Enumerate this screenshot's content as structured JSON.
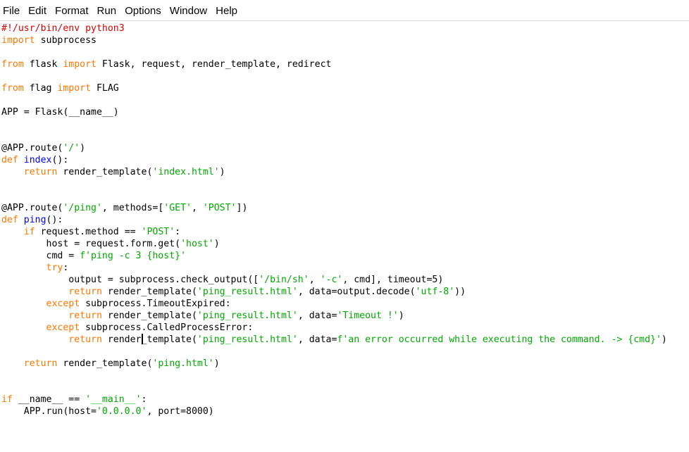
{
  "menubar": {
    "items": [
      "File",
      "Edit",
      "Format",
      "Run",
      "Options",
      "Window",
      "Help"
    ]
  },
  "colors": {
    "keyword": "#ff7700",
    "string": "#00aa00",
    "definition": "#0000ff",
    "comment": "#dd0000",
    "text": "#000000"
  },
  "editor": {
    "cursor_line": 28,
    "lines": [
      [
        [
          "cmt",
          "#!/usr/bin/env python3"
        ]
      ],
      [
        [
          "kw",
          "import"
        ],
        [
          "",
          " subprocess"
        ]
      ],
      [],
      [
        [
          "kw",
          "from"
        ],
        [
          "",
          " flask "
        ],
        [
          "kw",
          "import"
        ],
        [
          "",
          " Flask, request, render_template, redirect"
        ]
      ],
      [],
      [
        [
          "kw",
          "from"
        ],
        [
          "",
          " flag "
        ],
        [
          "kw",
          "import"
        ],
        [
          "",
          " FLAG"
        ]
      ],
      [],
      [
        [
          "",
          "APP = Flask(__name__)"
        ]
      ],
      [],
      [],
      [
        [
          "",
          "@APP.route("
        ],
        [
          "str",
          "'/'"
        ],
        [
          "",
          ")"
        ]
      ],
      [
        [
          "kw",
          "def"
        ],
        [
          "",
          " "
        ],
        [
          "def",
          "index"
        ],
        [
          "",
          "():"
        ]
      ],
      [
        [
          "",
          "    "
        ],
        [
          "kw",
          "return"
        ],
        [
          "",
          " render_template("
        ],
        [
          "str",
          "'index.html'"
        ],
        [
          "",
          ")"
        ]
      ],
      [],
      [],
      [
        [
          "",
          "@APP.route("
        ],
        [
          "str",
          "'/ping'"
        ],
        [
          "",
          ", methods=["
        ],
        [
          "str",
          "'GET'"
        ],
        [
          "",
          ", "
        ],
        [
          "str",
          "'POST'"
        ],
        [
          "",
          "])"
        ]
      ],
      [
        [
          "kw",
          "def"
        ],
        [
          "",
          " "
        ],
        [
          "def",
          "ping"
        ],
        [
          "",
          "():"
        ]
      ],
      [
        [
          "",
          "    "
        ],
        [
          "kw",
          "if"
        ],
        [
          "",
          " request.method == "
        ],
        [
          "str",
          "'POST'"
        ],
        [
          "",
          ":"
        ]
      ],
      [
        [
          "",
          "        host = request.form.get("
        ],
        [
          "str",
          "'host'"
        ],
        [
          "",
          ")"
        ]
      ],
      [
        [
          "",
          "        cmd = "
        ],
        [
          "str",
          "f'ping -c 3 {host}'"
        ]
      ],
      [
        [
          "",
          "        "
        ],
        [
          "kw",
          "try"
        ],
        [
          "",
          ":"
        ]
      ],
      [
        [
          "",
          "            output = subprocess.check_output(["
        ],
        [
          "str",
          "'/bin/sh'"
        ],
        [
          "",
          ", "
        ],
        [
          "str",
          "'-c'"
        ],
        [
          "",
          ", cmd], timeout=5)"
        ]
      ],
      [
        [
          "",
          "            "
        ],
        [
          "kw",
          "return"
        ],
        [
          "",
          " render_template("
        ],
        [
          "str",
          "'ping_result.html'"
        ],
        [
          "",
          ", data=output.decode("
        ],
        [
          "str",
          "'utf-8'"
        ],
        [
          "",
          "))"
        ]
      ],
      [
        [
          "",
          "        "
        ],
        [
          "kw",
          "except"
        ],
        [
          "",
          " subprocess.TimeoutExpired:"
        ]
      ],
      [
        [
          "",
          "            "
        ],
        [
          "kw",
          "return"
        ],
        [
          "",
          " render_template("
        ],
        [
          "str",
          "'ping_result.html'"
        ],
        [
          "",
          ", data="
        ],
        [
          "str",
          "'Timeout !'"
        ],
        [
          "",
          ")"
        ]
      ],
      [
        [
          "",
          "        "
        ],
        [
          "kw",
          "except"
        ],
        [
          "",
          " subprocess.CalledProcessError:"
        ]
      ],
      [
        [
          "",
          "            "
        ],
        [
          "kw",
          "return"
        ],
        [
          "",
          " render"
        ],
        [
          "cursor",
          ""
        ],
        [
          "",
          "_template("
        ],
        [
          "str",
          "'ping_result.html'"
        ],
        [
          "",
          ", data="
        ],
        [
          "str",
          "f'an error occurred while executing the command. -> {cmd}'"
        ],
        [
          "",
          ")"
        ]
      ],
      [],
      [
        [
          "",
          "    "
        ],
        [
          "kw",
          "return"
        ],
        [
          "",
          " render_template("
        ],
        [
          "str",
          "'ping.html'"
        ],
        [
          "",
          ")"
        ]
      ],
      [],
      [],
      [
        [
          "kw",
          "if"
        ],
        [
          "",
          " __name__ == "
        ],
        [
          "str",
          "'__main__'"
        ],
        [
          "",
          ":"
        ]
      ],
      [
        [
          "",
          "    APP.run(host="
        ],
        [
          "str",
          "'0.0.0.0'"
        ],
        [
          "",
          ", port=8000)"
        ]
      ]
    ]
  }
}
